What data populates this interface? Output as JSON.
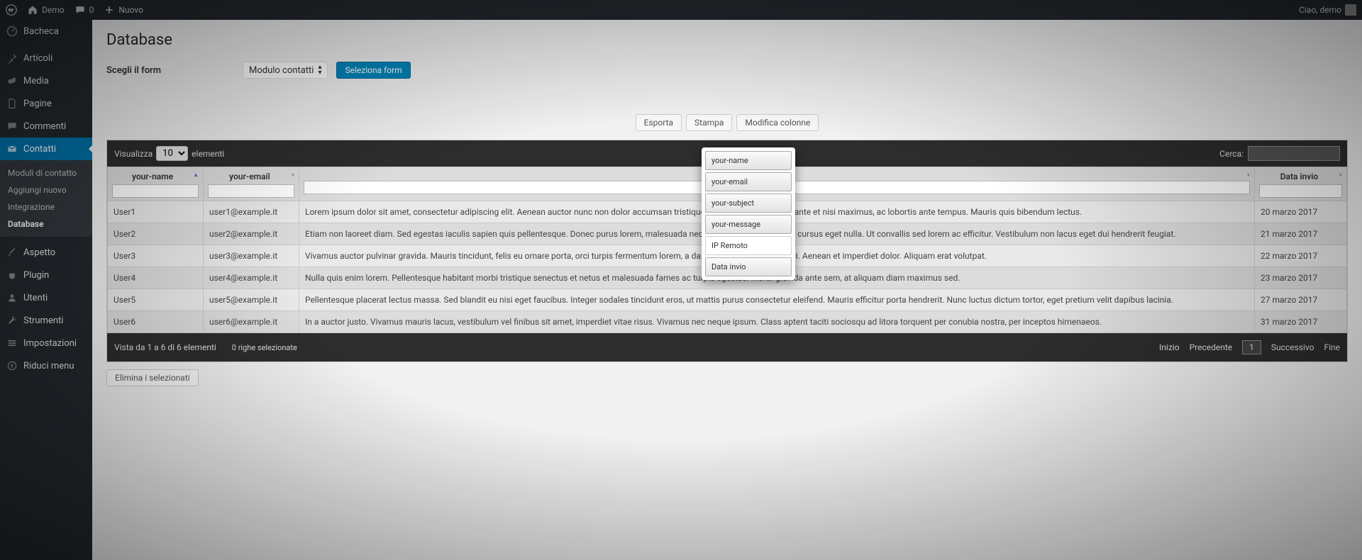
{
  "adminbar": {
    "site": "Demo",
    "comments": "0",
    "new": "Nuovo",
    "greeting": "Ciao, demo"
  },
  "sidebar": {
    "items": [
      {
        "label": "Bacheca",
        "icon": "dashboard-icon"
      },
      {
        "label": "Articoli",
        "icon": "pin-icon"
      },
      {
        "label": "Media",
        "icon": "media-icon"
      },
      {
        "label": "Pagine",
        "icon": "page-icon"
      },
      {
        "label": "Commenti",
        "icon": "comment-icon"
      },
      {
        "label": "Contatti",
        "icon": "mail-icon",
        "current": true
      },
      {
        "label": "Aspetto",
        "icon": "brush-icon"
      },
      {
        "label": "Plugin",
        "icon": "plugin-icon"
      },
      {
        "label": "Utenti",
        "icon": "users-icon"
      },
      {
        "label": "Strumenti",
        "icon": "tools-icon"
      },
      {
        "label": "Impostazioni",
        "icon": "settings-icon"
      },
      {
        "label": "Riduci menu",
        "icon": "collapse-icon"
      }
    ],
    "submenu": [
      {
        "label": "Moduli di contatto"
      },
      {
        "label": "Aggiungi nuovo"
      },
      {
        "label": "Integrazione"
      },
      {
        "label": "Database",
        "current": true
      }
    ]
  },
  "page": {
    "title": "Database",
    "form_label": "Scegli il form",
    "form_select_value": "Modulo contatti",
    "select_btn": "Seleziona form",
    "toolbar": {
      "export": "Esporta",
      "print": "Stampa",
      "edit_cols": "Modifica colonne"
    },
    "delete_selected": "Elimina i selezionati"
  },
  "table": {
    "length_prefix": "Visualizza",
    "length_value": "10",
    "length_suffix": "elementi",
    "search_label": "Cerca:",
    "columns": [
      "your-name",
      "your-email",
      "",
      "Data invio"
    ],
    "rows": [
      {
        "name": "User1",
        "email": "user1@example.it",
        "msg": "Lorem ipsum dolor sit amet, consectetur adipiscing elit. Aenean auctor nunc non dolor accumsan tristique. Integer in quam turpis ante et nisi maximus, ac lobortis ante tempus. Mauris quis bibendum lectus.",
        "date": "20 marzo 2017"
      },
      {
        "name": "User2",
        "email": "user2@example.it",
        "msg": "Etiam non laoreet diam. Sed egestas iaculis sapien quis pellentesque. Donec purus lorem, malesuada nec, tincidunt risus vehicula, cursus eget nulla. Ut convallis sed lorem ac efficitur. Vestibulum non lacus eget dui hendrerit feugiat.",
        "date": "21 marzo 2017"
      },
      {
        "name": "User3",
        "email": "user3@example.it",
        "msg": "Vivamus auctor pulvinar gravida. Mauris tincidunt, felis eu ornare porta, orci turpis fermentum lorem, a dapibus lectus eros non orci. Aenean et imperdiet dolor. Aliquam erat volutpat.",
        "date": "22 marzo 2017"
      },
      {
        "name": "User4",
        "email": "user4@example.it",
        "msg": "Nulla quis enim lorem. Pellentesque habitant morbi tristique senectus et netus et malesuada fames ac turpis egestas. Morbi gravida ante sem, at aliquam diam maximus sed.",
        "date": "23 marzo 2017"
      },
      {
        "name": "User5",
        "email": "user5@example.it",
        "msg": "Pellentesque placerat lectus massa. Sed blandit eu nisi eget faucibus. Integer sodales tincidunt eros, ut mattis purus consectetur eleifend. Mauris efficitur porta hendrerit. Nunc luctus dictum tortor, eget pretium velit dapibus lacinia.",
        "date": "27 marzo 2017"
      },
      {
        "name": "User6",
        "email": "user6@example.it",
        "msg": "In a auctor justo. Vivamus mauris lacus, vestibulum vel finibus sit amet, imperdiet vitae risus. Vivamus nec neque ipsum. Class aptent taciti sociosqu ad litora torquent per conubia nostra, per inceptos himenaeos.",
        "date": "31 marzo 2017"
      }
    ],
    "info": "Vista da 1 a 6 di 6 elementi",
    "selected_info": "0 righe selezionate",
    "paging": {
      "first": "Inizio",
      "prev": "Precedente",
      "page": "1",
      "next": "Successivo",
      "last": "Fine"
    }
  },
  "col_popup": {
    "options": [
      {
        "label": "your-name",
        "on": true
      },
      {
        "label": "your-email",
        "on": true
      },
      {
        "label": "your-subject",
        "on": true
      },
      {
        "label": "your-message",
        "on": true
      },
      {
        "label": "IP Remoto",
        "on": false
      },
      {
        "label": "Data invio",
        "on": true
      }
    ]
  }
}
